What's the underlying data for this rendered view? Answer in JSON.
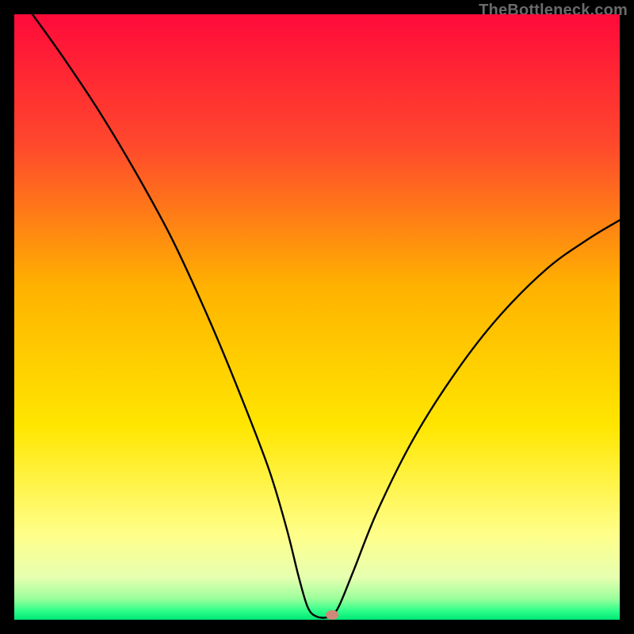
{
  "watermark": "TheBottleneck.com",
  "chart_data": {
    "type": "line",
    "title": "",
    "xlabel": "",
    "ylabel": "",
    "x_range": [
      0,
      100
    ],
    "y_range": [
      0,
      100
    ],
    "grid": false,
    "background_gradient": {
      "type": "vertical",
      "stops": [
        {
          "pos": 0.0,
          "color": "#ff0a3a"
        },
        {
          "pos": 0.22,
          "color": "#ff4a2c"
        },
        {
          "pos": 0.45,
          "color": "#ffb200"
        },
        {
          "pos": 0.68,
          "color": "#ffe600"
        },
        {
          "pos": 0.86,
          "color": "#ffff8a"
        },
        {
          "pos": 0.93,
          "color": "#e6ffb0"
        },
        {
          "pos": 0.965,
          "color": "#9cff9c"
        },
        {
          "pos": 0.985,
          "color": "#2fff8a"
        },
        {
          "pos": 1.0,
          "color": "#00e676"
        }
      ]
    },
    "series": [
      {
        "name": "bottleneck-curve",
        "color": "#000000",
        "width": 2.4,
        "points": [
          {
            "x": 3,
            "y": 100
          },
          {
            "x": 8,
            "y": 93
          },
          {
            "x": 14,
            "y": 84
          },
          {
            "x": 20,
            "y": 74
          },
          {
            "x": 26,
            "y": 63
          },
          {
            "x": 32,
            "y": 50
          },
          {
            "x": 37,
            "y": 38
          },
          {
            "x": 42,
            "y": 25
          },
          {
            "x": 45,
            "y": 15
          },
          {
            "x": 47,
            "y": 7
          },
          {
            "x": 48.5,
            "y": 2
          },
          {
            "x": 50,
            "y": 0.5
          },
          {
            "x": 52,
            "y": 0.5
          },
          {
            "x": 53.5,
            "y": 2
          },
          {
            "x": 56,
            "y": 8
          },
          {
            "x": 60,
            "y": 18
          },
          {
            "x": 66,
            "y": 30
          },
          {
            "x": 73,
            "y": 41
          },
          {
            "x": 80,
            "y": 50
          },
          {
            "x": 88,
            "y": 58
          },
          {
            "x": 95,
            "y": 63
          },
          {
            "x": 100,
            "y": 66
          }
        ]
      }
    ],
    "marker": {
      "name": "optimal-point",
      "x": 52.5,
      "y": 0.8,
      "color": "#d08878",
      "rx": 8,
      "ry": 6
    }
  }
}
